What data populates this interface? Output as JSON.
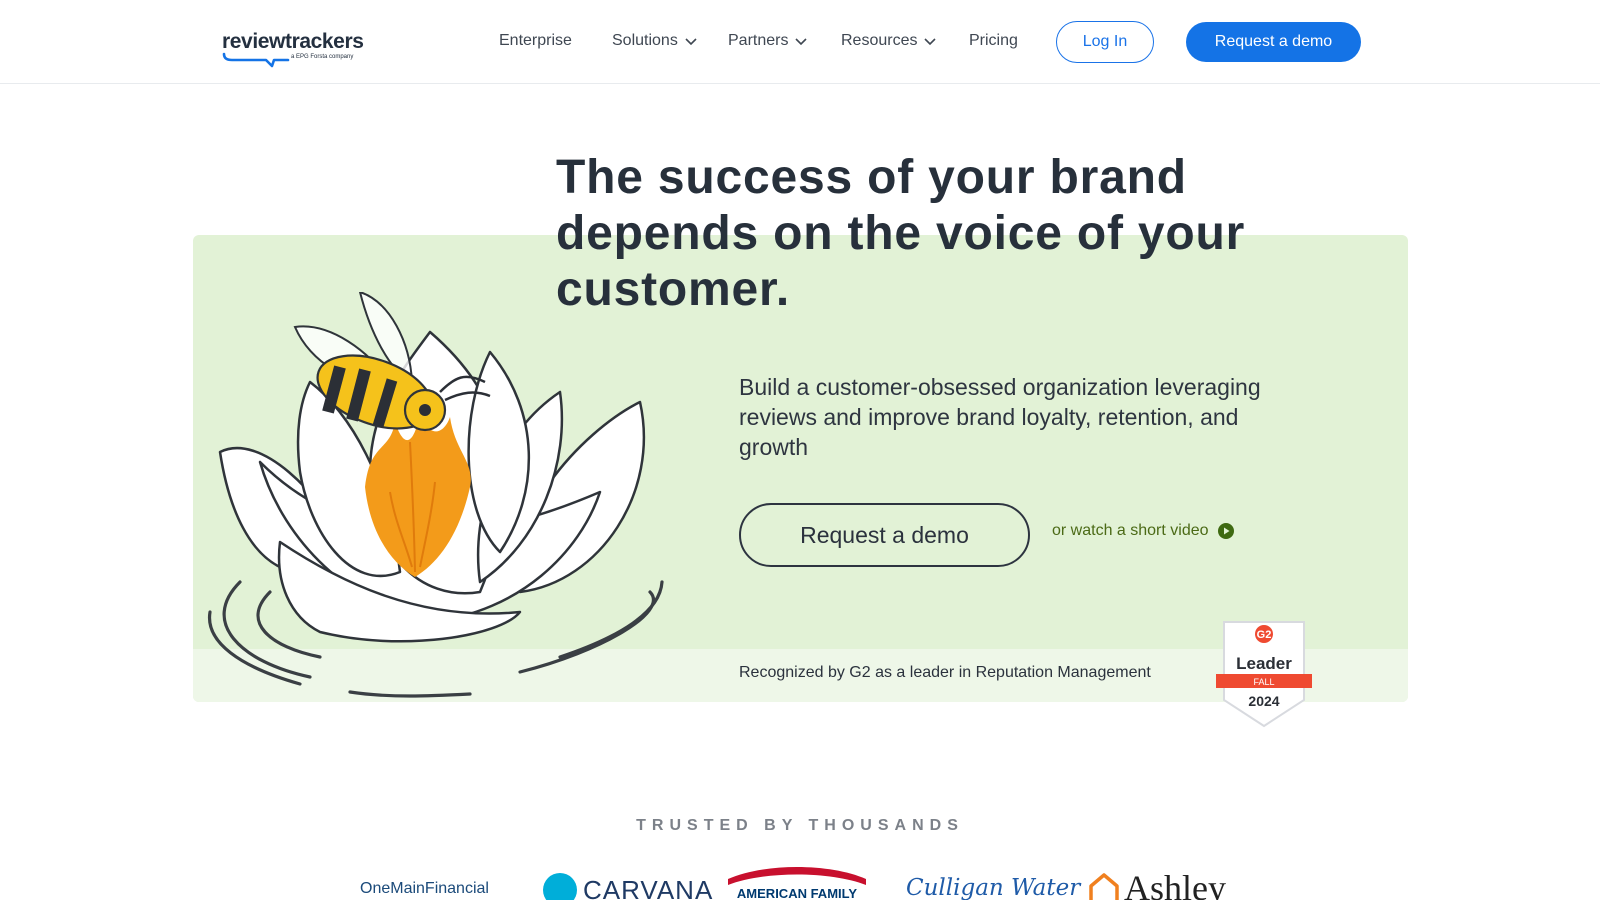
{
  "header": {
    "logo_text": "reviewtrackers",
    "logo_subtitle": "a EPG Forsta company",
    "nav": [
      {
        "label": "Enterprise",
        "has_dropdown": false
      },
      {
        "label": "Solutions",
        "has_dropdown": true
      },
      {
        "label": "Partners",
        "has_dropdown": true
      },
      {
        "label": "Resources",
        "has_dropdown": true
      },
      {
        "label": "Pricing",
        "has_dropdown": false
      }
    ],
    "login_label": "Log In",
    "demo_label": "Request a demo"
  },
  "hero": {
    "title": "The success of your brand depends on the voice of your customer.",
    "subtitle": "Build a customer-obsessed organization leveraging reviews and improve brand loyalty, retention, and growth",
    "cta_label": "Request a demo",
    "video_link_label": "or watch a short video",
    "g2_text": "Recognized by G2 as a leader in Reputation Management",
    "badge": {
      "brand": "G2",
      "title": "Leader",
      "season": "FALL",
      "year": "2024"
    }
  },
  "trusted": {
    "heading": "TRUSTED BY THOUSANDS",
    "logos": [
      {
        "name": "OneMain Financial",
        "part1": "OneMain",
        "part2": "Financial"
      },
      {
        "name": "Carvana",
        "text": "CARVANA"
      },
      {
        "name": "American Family",
        "text": "AMERICAN FAMILY"
      },
      {
        "name": "Culligan Water",
        "text": "Culligan Water"
      },
      {
        "name": "Ashley",
        "text": "Ashley"
      }
    ]
  },
  "colors": {
    "primary_blue": "#1473e6",
    "hero_green": "#e2f2d6",
    "text_dark": "#27303b",
    "link_green": "#4b6a16",
    "g2_red": "#ef4a31"
  }
}
